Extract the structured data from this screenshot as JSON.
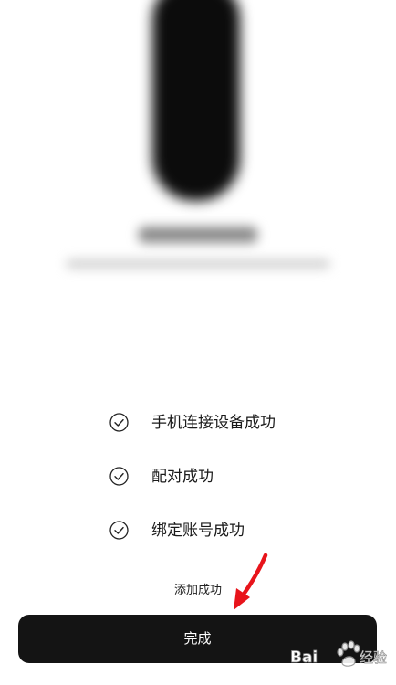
{
  "device_preview": {
    "image": "blurred-device-image"
  },
  "steps": [
    {
      "label": "手机连接设备成功",
      "icon": "check-circle-icon"
    },
    {
      "label": "配对成功",
      "icon": "check-circle-icon"
    },
    {
      "label": "绑定账号成功",
      "icon": "check-circle-icon"
    }
  ],
  "status": {
    "text": "添加成功"
  },
  "footer": {
    "done_label": "完成"
  },
  "annotation": {
    "arrow_color": "#e8141b"
  },
  "watermark": {
    "text": "Bai经验",
    "icon": "paw-icon"
  },
  "colors": {
    "button_bg": "#141414",
    "button_text": "#ffffff",
    "text": "#1a1a1a"
  }
}
